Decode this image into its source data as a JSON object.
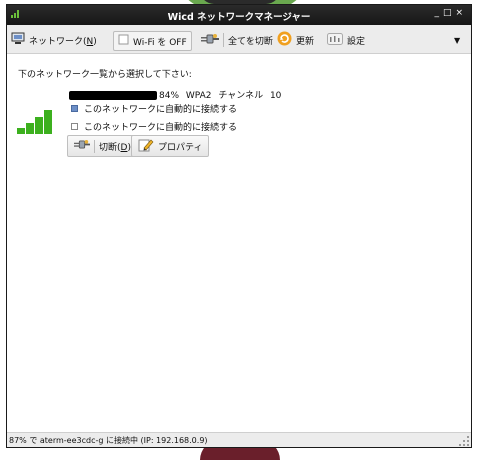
{
  "window": {
    "title": "Wicd ネットワークマネージャー",
    "minimize_glyph": "_",
    "maximize_glyph": "□",
    "close_glyph": "×"
  },
  "toolbar": {
    "network_label": "ネットワーク(",
    "network_mnemonic": "N",
    "network_close": ")",
    "wifi_label": "Wi-Fi を OFF",
    "disconnect_all_label": "全てを切断",
    "refresh_label": "更新",
    "settings_label": "設定",
    "menu_glyph": "▼"
  },
  "main": {
    "prompt": "下のネットワーク一覧から選択して下さい:",
    "network": {
      "info": "84%  WPA2  チャンネル 10",
      "signal_percent": 84,
      "auto_connect_1": {
        "label": "このネットワークに自動的に接続する",
        "checked": true
      },
      "auto_connect_2": {
        "label": "このネットワークに自動的に接続する",
        "checked": false
      },
      "disconnect_label": "切断(",
      "disconnect_mnemonic": "D",
      "disconnect_close": ")",
      "properties_label": "プロパティ"
    }
  },
  "status": {
    "text": "87% で aterm-ee3cdc-g に接続中 (IP: 192.168.0.9)"
  },
  "colors": {
    "signal_green": "#3cb01e",
    "titlebar": "#1f1f1f",
    "checkbox_checked": "#6d8fc7"
  }
}
